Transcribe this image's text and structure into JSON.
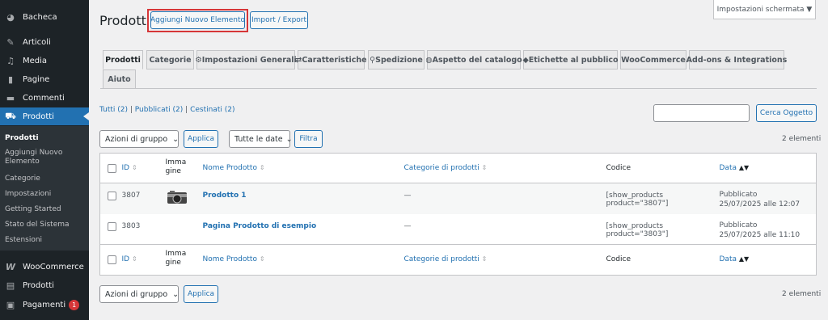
{
  "sidebar": {
    "items": [
      {
        "label": "Bacheca",
        "icon": "dashboard-icon"
      },
      {
        "label": "Articoli",
        "icon": "pin-icon"
      },
      {
        "label": "Media",
        "icon": "media-icon"
      },
      {
        "label": "Pagine",
        "icon": "page-icon"
      },
      {
        "label": "Commenti",
        "icon": "comment-icon"
      },
      {
        "label": "Prodotti",
        "icon": "cart-icon"
      }
    ],
    "submenu": [
      "Prodotti",
      "Aggiungi Nuovo Elemento",
      "Categorie",
      "Impostazioni",
      "Getting Started",
      "Stato del Sistema",
      "Estensioni"
    ],
    "bottom": [
      {
        "label": "WooCommerce",
        "icon": "woo-icon"
      },
      {
        "label": "Prodotti",
        "icon": "archive-icon"
      },
      {
        "label": "Pagamenti",
        "icon": "payment-icon",
        "badge": "1"
      }
    ]
  },
  "header": {
    "title": "Prodotti",
    "add_new": "Aggiungi Nuovo Elemento",
    "import_export": "Import / Export",
    "screen_options": "Impostazioni schermata ▼"
  },
  "tabs": [
    "Prodotti",
    "Categorie",
    "Impostazioni Generali",
    "Caratteristiche",
    "Spedizione",
    "Aspetto del catalogo",
    "Etichette al pubblico",
    "WooCommerce",
    "Add-ons & Integrations",
    "Aiuto"
  ],
  "filters": {
    "all": "Tutti (2)",
    "published": "Pubblicati (2)",
    "trash": "Cestinati (2)",
    "search_button": "Cerca Oggetto",
    "bulk_action": "Azioni di gruppo",
    "apply": "Applica",
    "dates": "Tutte le date",
    "filter": "Filtra",
    "count": "2 elementi"
  },
  "table": {
    "headers": {
      "id": "ID",
      "image": "Immagine",
      "name": "Nome Prodotto",
      "categories": "Categorie di prodotti",
      "code": "Codice",
      "date": "Data"
    },
    "rows": [
      {
        "id": "3807",
        "name": "Prodotto 1",
        "categories": "—",
        "code": "[show_products product=\"3807\"]",
        "status": "Pubblicato",
        "date": "25/07/2025 alle 12:07"
      },
      {
        "id": "3803",
        "name": "Pagina Prodotto di esempio",
        "categories": "—",
        "code": "[show_products product=\"3803\"]",
        "status": "Pubblicato",
        "date": "25/07/2025 alle 11:10"
      }
    ]
  },
  "colors": {
    "accent": "#2271b1",
    "sidebar": "#1d2327",
    "highlight": "#d63638"
  }
}
